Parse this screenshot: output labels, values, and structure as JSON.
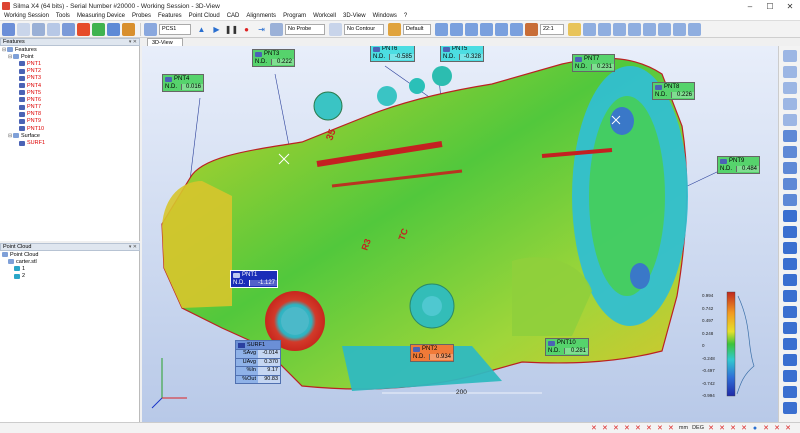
{
  "window": {
    "title": "Silma X4 (64 bits) - Serial Number #20000 - Working Session - 3D-View",
    "buttons": [
      "–",
      "☐",
      "✕"
    ]
  },
  "menu": [
    "Working Session",
    "Tools",
    "Measuring Device",
    "Probes",
    "Features",
    "Point Cloud",
    "CAD",
    "Alignments",
    "Program",
    "Workcell",
    "3D-View",
    "Windows",
    "?"
  ],
  "toolbar": {
    "frame_select": "PCS1",
    "probe_select": "No Probe",
    "contour_select": "No Contour",
    "default_select": "Default",
    "zoom_value": "22:1"
  },
  "features_panel": {
    "title": "Features",
    "items": [
      {
        "label": "Features",
        "level": 0,
        "expand": "⊟",
        "red": false
      },
      {
        "label": "Point",
        "level": 1,
        "expand": "⊟",
        "red": false
      },
      {
        "label": "PNT1",
        "level": 2,
        "expand": "",
        "red": true
      },
      {
        "label": "PNT2",
        "level": 2,
        "expand": "",
        "red": true
      },
      {
        "label": "PNT3",
        "level": 2,
        "expand": "",
        "red": true
      },
      {
        "label": "PNT4",
        "level": 2,
        "expand": "",
        "red": true
      },
      {
        "label": "PNT5",
        "level": 2,
        "expand": "",
        "red": true
      },
      {
        "label": "PNT6",
        "level": 2,
        "expand": "",
        "red": true
      },
      {
        "label": "PNT7",
        "level": 2,
        "expand": "",
        "red": true
      },
      {
        "label": "PNT8",
        "level": 2,
        "expand": "",
        "red": true
      },
      {
        "label": "PNT9",
        "level": 2,
        "expand": "",
        "red": true
      },
      {
        "label": "PNT10",
        "level": 2,
        "expand": "",
        "red": true
      },
      {
        "label": "Surface",
        "level": 1,
        "expand": "⊟",
        "red": false
      },
      {
        "label": "SURF1",
        "level": 2,
        "expand": "",
        "red": true
      }
    ]
  },
  "pointcloud_panel": {
    "title": "Point Cloud",
    "items": [
      {
        "label": "Point Cloud",
        "level": 0
      },
      {
        "label": "carter.stl",
        "level": 1
      },
      {
        "label": "1",
        "level": 2
      },
      {
        "label": "2",
        "level": 2
      }
    ]
  },
  "view_tab": "3D-View",
  "labels": {
    "pnt1": {
      "name": "PNT1",
      "key": "N.D.",
      "value": "-1.127"
    },
    "pnt2": {
      "name": "PNT2",
      "key": "N.D.",
      "value": "0.934"
    },
    "pnt3": {
      "name": "PNT3",
      "key": "N.D.",
      "value": "0.222"
    },
    "pnt4": {
      "name": "PNT4",
      "key": "N.D.",
      "value": "0.016"
    },
    "pnt5": {
      "name": "PNT5",
      "key": "N.D.",
      "value": "-0.328"
    },
    "pnt6": {
      "name": "PNT6",
      "key": "N.D.",
      "value": "-0.585"
    },
    "pnt7": {
      "name": "PNT7",
      "key": "N.D.",
      "value": "0.231"
    },
    "pnt8": {
      "name": "PNT8",
      "key": "N.D.",
      "value": "0.226"
    },
    "pnt9": {
      "name": "PNT9",
      "key": "N.D.",
      "value": "0.484"
    },
    "pnt10": {
      "name": "PNT10",
      "key": "N.D.",
      "value": "0.281"
    }
  },
  "surface": {
    "name": "SURF1",
    "rows": [
      {
        "k": "SAvg",
        "v": "-0.014"
      },
      {
        "k": "UAvg",
        "v": "0.370"
      },
      {
        "k": "%In",
        "v": "9.17"
      },
      {
        "k": "%Out",
        "v": "90.83"
      }
    ]
  },
  "scale": {
    "ticks": [
      "0.994",
      "0.742",
      "0.497",
      "0.248",
      "0",
      "-0.248",
      "-0.497",
      "-0.742",
      "-0.994"
    ],
    "ruler": "200"
  },
  "status": {
    "units": "mm",
    "angle": "DEG"
  },
  "colors": {
    "accent": "#4b63b5",
    "label_green": "#56d36c",
    "label_cyan": "#4cdde2",
    "label_orange": "#f07a38"
  }
}
